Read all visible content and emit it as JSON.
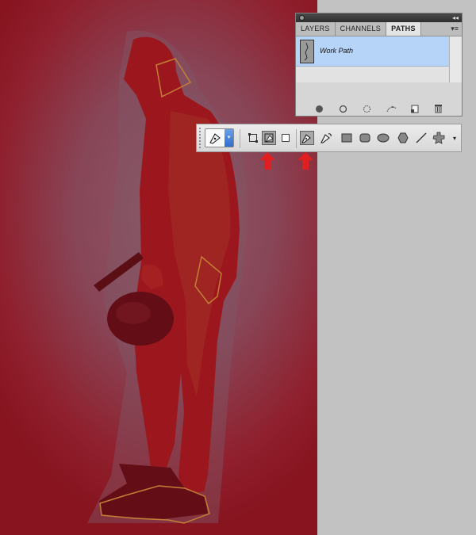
{
  "panel": {
    "tabs": [
      {
        "label": "LAYERS",
        "active": false
      },
      {
        "label": "CHANNELS",
        "active": false
      },
      {
        "label": "PATHS",
        "active": true
      }
    ],
    "collapse_glyph": "◂◂",
    "menu_glyph": "▾≡",
    "paths": [
      {
        "name": "Work Path",
        "selected": true
      }
    ],
    "footer_icons": [
      "fill-path-icon",
      "stroke-path-icon",
      "load-selection-icon",
      "make-work-path-icon",
      "new-path-icon",
      "delete-path-icon"
    ]
  },
  "options_bar": {
    "preset_arrow": "▾",
    "mode_buttons": [
      {
        "name": "shape-layers-mode",
        "pressed": false
      },
      {
        "name": "paths-mode",
        "pressed": true
      },
      {
        "name": "fill-pixels-mode",
        "pressed": false
      }
    ],
    "tools": [
      {
        "name": "pen-tool",
        "pressed": true
      },
      {
        "name": "freeform-pen-tool",
        "pressed": false
      },
      {
        "name": "rectangle-tool",
        "pressed": false
      },
      {
        "name": "rounded-rectangle-tool",
        "pressed": false
      },
      {
        "name": "ellipse-tool",
        "pressed": false
      },
      {
        "name": "polygon-tool",
        "pressed": false
      },
      {
        "name": "line-tool",
        "pressed": false
      },
      {
        "name": "custom-shape-tool",
        "pressed": false
      }
    ],
    "more_glyph": "▾"
  },
  "annotations": {
    "arrow_color": "#e02020",
    "path_stroke_color": "#e8d64a"
  },
  "colors": {
    "panel_bg": "#d6d6d6",
    "selected_row": "#b6d4f8",
    "quick_mask": "#9b1a24"
  }
}
